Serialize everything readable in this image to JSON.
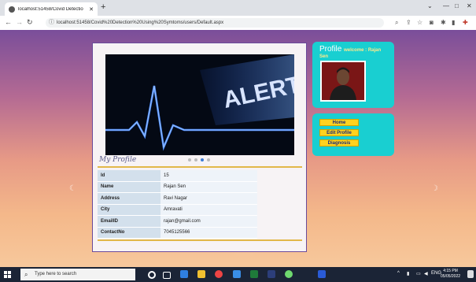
{
  "browser": {
    "tab_title": "localhost:51458/Covid Detectio",
    "url": "localhost:51458/Covid%20Detection%20Using%20Symtoms/users/Default.aspx"
  },
  "banner": {
    "alert_text": "ALERT"
  },
  "carousel": {
    "count": 4,
    "active": 3
  },
  "section_title": "My Profile",
  "profile_table": [
    {
      "label": "Id",
      "value": "15"
    },
    {
      "label": "Name",
      "value": "Rajan Sen"
    },
    {
      "label": "Address",
      "value": "Ravi Nagar"
    },
    {
      "label": "City",
      "value": "Amravati"
    },
    {
      "label": "EmailID",
      "value": "rajan@gmail.com"
    },
    {
      "label": "ContactNo",
      "value": "7045125566"
    }
  ],
  "profile_box": {
    "heading": "Profile",
    "welcome": "welcome : Rajan",
    "welcome_cont": "Sen"
  },
  "menu": [
    {
      "label": "Home"
    },
    {
      "label": "Edit Profile"
    },
    {
      "label": "Diagnosis"
    }
  ],
  "taskbar": {
    "search_placeholder": "Type here to search",
    "lang": "ENG",
    "time": "4:15 PM",
    "date": "05/05/2022"
  },
  "colors": {
    "panel_accent": "#19cfd1",
    "button_yellow": "#ffd21f",
    "rule_gold": "#e2b84a"
  }
}
